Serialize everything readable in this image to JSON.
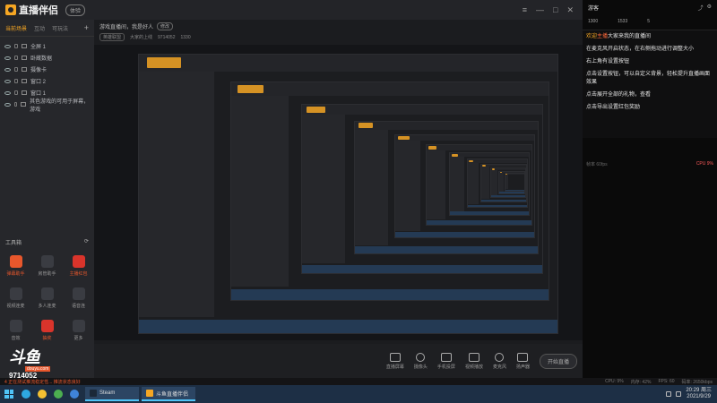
{
  "app": {
    "name": "直播伴侣",
    "badge": "体验",
    "top_actions": [
      "≡",
      "—",
      "□",
      "✕"
    ]
  },
  "sidebar": {
    "tabs": [
      "当前场景",
      "互动",
      "可玩法"
    ],
    "add_label": "+",
    "scenes": [
      {
        "label": "全屏 1"
      },
      {
        "label": "卧蔵数据"
      },
      {
        "label": "摄像卡"
      },
      {
        "label": "窗口 2"
      },
      {
        "label": "窗口 1"
      },
      {
        "label": "其色游戏的可用于屏幕，游戏"
      }
    ]
  },
  "toolbox": {
    "title": "工具箱",
    "tools": [
      {
        "label": "弹幕助手",
        "icon": "barrage-icon",
        "style": "orange",
        "hot": true
      },
      {
        "label": "房管助手",
        "icon": "manager-icon",
        "style": "",
        "hot": false
      },
      {
        "label": "主播红包",
        "icon": "redpack-icon",
        "style": "red",
        "hot": true
      },
      {
        "label": "视频连麦",
        "icon": "video-link-icon",
        "style": "",
        "hot": false
      },
      {
        "label": "多人连麦",
        "icon": "multi-link-icon",
        "style": "",
        "hot": false
      },
      {
        "label": "语音连",
        "icon": "voice-icon",
        "style": "",
        "hot": false
      },
      {
        "label": "音效",
        "icon": "sound-icon",
        "style": "",
        "hot": false
      },
      {
        "label": "抽奖",
        "icon": "lottery-icon",
        "style": "red",
        "hot": true
      },
      {
        "label": "更多",
        "icon": "more-icon",
        "style": "",
        "hot": false
      }
    ]
  },
  "watermark": {
    "brand": "斗鱼",
    "sub": "douyu.com",
    "room_id": "9714052"
  },
  "stream": {
    "title": "游戏直播间，我是好人",
    "edit": "修改",
    "category": "英雄联盟",
    "platform": "大家的上线",
    "room": "9714052",
    "fans": "1330"
  },
  "controls": [
    {
      "label": "直播屏幕",
      "icon": "screen-icon"
    },
    {
      "label": "摄像头",
      "icon": "camera-icon"
    },
    {
      "label": "手机投屏",
      "icon": "phone-cast-icon"
    },
    {
      "label": "视频播放",
      "icon": "video-play-icon"
    },
    {
      "label": "麦克风",
      "icon": "mic-icon"
    },
    {
      "label": "扬声器",
      "icon": "speaker-icon"
    }
  ],
  "start_button": "开始直播",
  "chat": {
    "user_name": "游客",
    "stats": [
      "1300",
      "1533",
      "5"
    ],
    "messages": [
      {
        "nick": "欢迎",
        "hl": "主播",
        "text": "大家来我的直播间"
      },
      {
        "nick": "",
        "hl": "",
        "text": "在麦克风开启状态，在右侧拖动进行调整大小"
      },
      {
        "nick": "",
        "hl": "",
        "text": "右上角有设置按钮"
      },
      {
        "nick": "",
        "hl": "",
        "text": "点击设置按钮，可以自定义背景，轻松提升直播画面效果"
      },
      {
        "nick": "",
        "hl": "",
        "text": "点击展开全部的礼物，查看"
      },
      {
        "nick": "",
        "hl": "",
        "text": "点击导出设置红包奖励"
      }
    ],
    "footer_left": "帧率 60fps",
    "footer_right": "CPU 9%"
  },
  "status": {
    "left": "4 正在测试推流稳定性... 推流状态良好",
    "items": [
      "CPU: 9%",
      "内存: 42%",
      "FPS: 60",
      "码率: 2650kbps"
    ]
  },
  "taskbar": {
    "apps": [
      {
        "icon": "edge-icon",
        "color": "#2ea8e0"
      },
      {
        "icon": "explorer-icon",
        "color": "#f3c032"
      },
      {
        "icon": "chrome-icon",
        "color": "#4caf50"
      },
      {
        "icon": "ie-icon",
        "color": "#3f84d9"
      }
    ],
    "windows": [
      {
        "label": "Steam",
        "color": "#1b2838"
      },
      {
        "label": "斗鱼直播伴侣",
        "color": "#f5a623"
      }
    ],
    "time": "20:29 周三",
    "date": "2021/9/29"
  }
}
